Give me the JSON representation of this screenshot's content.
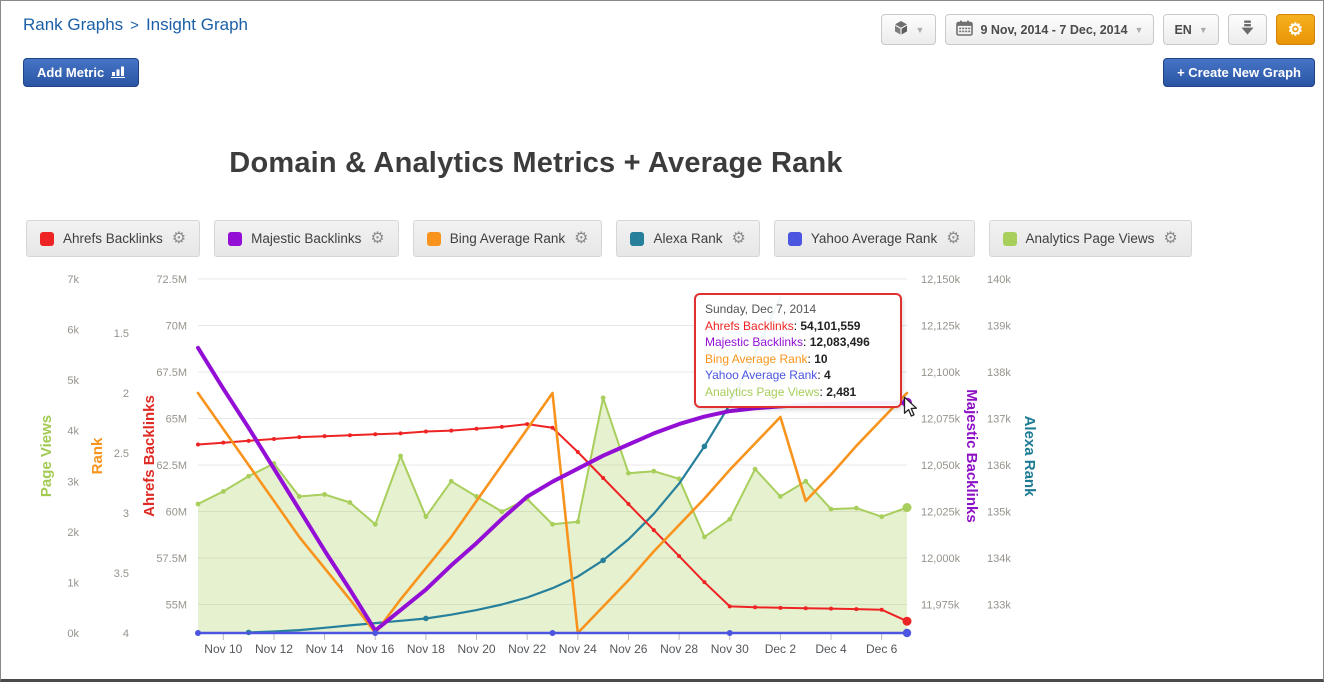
{
  "breadcrumb": {
    "section": "Rank Graphs",
    "separator": ">",
    "current": "Insight Graph"
  },
  "toolbar": {
    "date_range": "9 Nov, 2014 - 7 Dec, 2014",
    "language": "EN"
  },
  "buttons": {
    "add_metric": "Add Metric",
    "create_new_graph": "+ Create New Graph"
  },
  "legend": {
    "items": [
      {
        "label": "Ahrefs Backlinks",
        "color": "#ee2424"
      },
      {
        "label": "Majestic Backlinks",
        "color": "#940fd6"
      },
      {
        "label": "Bing Average Rank",
        "color": "#f8941d"
      },
      {
        "label": "Alexa Rank",
        "color": "#27809b"
      },
      {
        "label": "Yahoo Average Rank",
        "color": "#4b55e0"
      },
      {
        "label": "Analytics Page Views",
        "color": "#a8ce5c"
      }
    ]
  },
  "tooltip": {
    "date": "Sunday, Dec 7, 2014",
    "rows": [
      {
        "label": "Ahrefs Backlinks",
        "value": "54,101,559",
        "color": "#ee2424"
      },
      {
        "label": "Majestic Backlinks",
        "value": "12,083,496",
        "color": "#940fd6"
      },
      {
        "label": "Bing Average Rank",
        "value": "10",
        "color": "#f8941d"
      },
      {
        "label": "Yahoo Average Rank",
        "value": "4",
        "color": "#4b55e0"
      },
      {
        "label": "Analytics Page Views",
        "value": "2,481",
        "color": "#a8ce5c"
      }
    ]
  },
  "chart_data": {
    "type": "line",
    "title": "Domain & Analytics Metrics + Average Rank",
    "grid": true,
    "x": {
      "dates": [
        "Nov 9",
        "Nov 10",
        "Nov 11",
        "Nov 12",
        "Nov 13",
        "Nov 14",
        "Nov 15",
        "Nov 16",
        "Nov 17",
        "Nov 18",
        "Nov 19",
        "Nov 20",
        "Nov 21",
        "Nov 22",
        "Nov 23",
        "Nov 24",
        "Nov 25",
        "Nov 26",
        "Nov 27",
        "Nov 28",
        "Nov 29",
        "Nov 30",
        "Dec 1",
        "Dec 2",
        "Dec 3",
        "Dec 4",
        "Dec 5",
        "Dec 6",
        "Dec 7"
      ],
      "labels": [
        "Nov 10",
        "Nov 12",
        "Nov 14",
        "Nov 16",
        "Nov 18",
        "Nov 20",
        "Nov 22",
        "Nov 24",
        "Nov 26",
        "Nov 28",
        "Nov 30",
        "Dec 2",
        "Dec 4",
        "Dec 6"
      ],
      "label_days": [
        1,
        3,
        5,
        7,
        9,
        11,
        13,
        15,
        17,
        19,
        21,
        23,
        25,
        27
      ]
    },
    "axes": [
      {
        "id": "pageviews",
        "title": "Page Views",
        "color": "#a3cb54",
        "side": "left",
        "ticks": {
          "labels": [
            "7k",
            "6k",
            "5k",
            "4k",
            "3k",
            "2k",
            "1k",
            "0k"
          ],
          "values": [
            7,
            6,
            5,
            4,
            3,
            2,
            1,
            0
          ]
        }
      },
      {
        "id": "rank",
        "title": "Rank",
        "color": "#f8941d",
        "side": "left",
        "ticks": {
          "labels": [
            "1.5",
            "2",
            "2.5",
            "3",
            "3.5",
            "4"
          ],
          "values": [
            1.5,
            2,
            2.5,
            3,
            3.5,
            4
          ]
        }
      },
      {
        "id": "ahrefs",
        "title": "Ahrefs Backlinks",
        "color": "#e02a24",
        "side": "left",
        "ticks": {
          "labels": [
            "72.5M",
            "70M",
            "67.5M",
            "65M",
            "62.5M",
            "60M",
            "57.5M",
            "55M"
          ],
          "values": [
            72.5,
            70,
            67.5,
            65,
            62.5,
            60,
            57.5,
            55
          ]
        }
      },
      {
        "id": "majestic",
        "title": "Majestic Backlinks",
        "color": "#8d10c4",
        "side": "right",
        "ticks": {
          "labels": [
            "12,150k",
            "12,125k",
            "12,100k",
            "12,075k",
            "12,050k",
            "12,025k",
            "12,000k",
            "11,975k"
          ],
          "values": [
            12150,
            12125,
            12100,
            12075,
            12050,
            12025,
            12000,
            11975
          ]
        }
      },
      {
        "id": "alexa",
        "title": "Alexa Rank",
        "color": "#1d7b93",
        "side": "right",
        "ticks": {
          "labels": [
            "140k",
            "139k",
            "138k",
            "137k",
            "136k",
            "135k",
            "134k",
            "133k"
          ],
          "values": [
            140,
            139,
            138,
            137,
            136,
            135,
            134,
            133
          ]
        }
      }
    ],
    "series": [
      {
        "name": "Analytics Page Views",
        "axis": "pageviews",
        "color": "#a8ce5c",
        "width": 2,
        "area": true,
        "fill": "rgba(166,206,87,0.28)",
        "markers": "all",
        "marker_r": 2.4,
        "end_dot_r": 4.5,
        "start_day": 0,
        "values": [
          2.55,
          2.8,
          3.1,
          3.35,
          2.7,
          2.74,
          2.58,
          2.15,
          3.5,
          2.3,
          3.0,
          2.7,
          2.4,
          2.65,
          2.15,
          2.2,
          4.65,
          3.16,
          3.2,
          3.05,
          1.9,
          2.25,
          3.24,
          2.7,
          3.0,
          2.45,
          2.47,
          2.3,
          2.481
        ]
      },
      {
        "name": "Alexa Rank",
        "axis": "alexa",
        "color": "#27809b",
        "width": 2.2,
        "markers": [
          2,
          9,
          16,
          20
        ],
        "marker_r": 2.8,
        "start_day": 2,
        "values": [
          132.4,
          132.42,
          132.45,
          132.5,
          132.55,
          132.6,
          132.65,
          132.7,
          132.78,
          132.88,
          133.0,
          133.15,
          133.35,
          133.6,
          133.95,
          134.4,
          134.95,
          135.6,
          136.4,
          137.3,
          138.4,
          139.6
        ]
      },
      {
        "name": "Ahrefs Backlinks",
        "axis": "ahrefs",
        "color": "#ee2424",
        "width": 2,
        "markers": "all",
        "marker_r": 2,
        "end_dot_r": 4.5,
        "start_day": 0,
        "values": [
          63.6,
          63.7,
          63.8,
          63.9,
          64.0,
          64.05,
          64.1,
          64.15,
          64.2,
          64.3,
          64.35,
          64.45,
          64.55,
          64.7,
          64.5,
          63.2,
          61.8,
          60.4,
          59.0,
          57.6,
          56.2,
          54.9,
          54.85,
          54.82,
          54.8,
          54.78,
          54.75,
          54.72,
          54.1
        ]
      },
      {
        "name": "Bing Average Rank",
        "axis": "bing",
        "color": "#f8941d",
        "width": 2.6,
        "markers": "none",
        "start_day": 0,
        "values": [
          10,
          11.5,
          13,
          14.5,
          16,
          17.3,
          18.6,
          20,
          18.6,
          17.3,
          16,
          14.5,
          13,
          11.5,
          10,
          20,
          18.9,
          17.8,
          16.6,
          15.5,
          14.4,
          13.2,
          12.1,
          11,
          14.5,
          13.4,
          12.2,
          11.1,
          10
        ]
      },
      {
        "name": "Majestic Backlinks",
        "axis": "majestic",
        "color": "#940fd6",
        "width": 4,
        "markers": "none",
        "end_dot_r": 5,
        "start_day": 0,
        "values": [
          12113,
          12091,
          12070,
          12048,
          12026,
          12004,
          11983,
          11961,
          11972,
          11983,
          11996,
          12008,
          12021,
          12033,
          12041,
          12048,
          12055,
          12061,
          12067,
          12072,
          12076,
          12079,
          12080.5,
          12081.5,
          12082.3,
          12082.8,
          12083.1,
          12083.3,
          12083.5
        ]
      },
      {
        "name": "Yahoo Average Rank",
        "axis": "rank",
        "color": "#4b55e0",
        "width": 2.4,
        "markers": "all",
        "marker_r": 3,
        "end_dot_r": 4.2,
        "days": [
          0,
          7,
          14,
          21,
          28
        ],
        "values": [
          4,
          4,
          4,
          4,
          4
        ]
      }
    ]
  }
}
